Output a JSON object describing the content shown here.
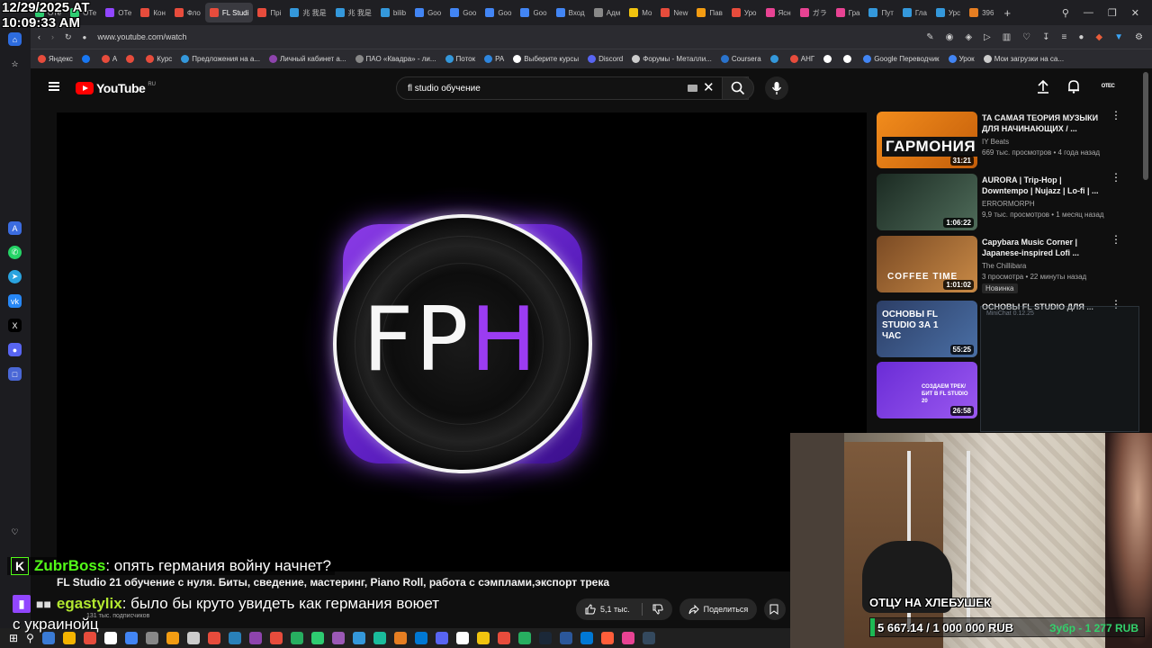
{
  "clock": {
    "date": "12/29/2025 AT",
    "time": "10:09:33 AM"
  },
  "tabs": [
    {
      "label": "ОТе",
      "color": "#2ecc71"
    },
    {
      "label": "ОТе",
      "color": "#2ecc71"
    },
    {
      "label": "ОТе",
      "color": "#9146ff"
    },
    {
      "label": "Кон",
      "color": "#e74c3c"
    },
    {
      "label": "Фло",
      "color": "#e74c3c"
    },
    {
      "label": "FL Studi",
      "color": "#e74c3c",
      "active": true
    },
    {
      "label": "Прі",
      "color": "#e74c3c"
    },
    {
      "label": "兆 我是",
      "color": "#3498db"
    },
    {
      "label": "兆 我是",
      "color": "#3498db"
    },
    {
      "label": "bilib",
      "color": "#3498db"
    },
    {
      "label": "Goo",
      "color": "#4285f4"
    },
    {
      "label": "Goo",
      "color": "#4285f4"
    },
    {
      "label": "Goo",
      "color": "#4285f4"
    },
    {
      "label": "Goo",
      "color": "#4285f4"
    },
    {
      "label": "Вход",
      "color": "#4285f4"
    },
    {
      "label": "Адм",
      "color": "#888888"
    },
    {
      "label": "Мо",
      "color": "#f1c40f"
    },
    {
      "label": "New",
      "color": "#e74c3c"
    },
    {
      "label": "Пав",
      "color": "#f39c12"
    },
    {
      "label": "Уро",
      "color": "#e74c3c"
    },
    {
      "label": "Ясн",
      "color": "#e84393"
    },
    {
      "label": "ガラ",
      "color": "#e84393"
    },
    {
      "label": "Гра",
      "color": "#e84393"
    },
    {
      "label": "Пут",
      "color": "#3498db"
    },
    {
      "label": "Гла",
      "color": "#3498db"
    },
    {
      "label": "Урс",
      "color": "#3498db"
    },
    {
      "label": "396",
      "color": "#e67e22"
    }
  ],
  "address": {
    "url": "www.youtube.com/watch"
  },
  "bookmarks": [
    {
      "label": "Яндекс",
      "color": "#e74c3c"
    },
    {
      "label": "",
      "color": "#1877f2"
    },
    {
      "label": "А",
      "color": "#e74c3c"
    },
    {
      "label": "",
      "color": "#e74c3c"
    },
    {
      "label": "Курс",
      "color": "#e74c3c"
    },
    {
      "label": "Предложения на а...",
      "color": "#3498db"
    },
    {
      "label": "Личный кабинет а...",
      "color": "#8e44ad"
    },
    {
      "label": "ПАО «Квадра» - ли...",
      "color": "#888888"
    },
    {
      "label": "Поток",
      "color": "#3498db"
    },
    {
      "label": "РА",
      "color": "#2e86de"
    },
    {
      "label": "Выберите курсы",
      "color": "#ffffff"
    },
    {
      "label": "Discord",
      "color": "#5865f2"
    },
    {
      "label": "Форумы - Металли...",
      "color": "#cccccc"
    },
    {
      "label": "Coursera",
      "color": "#2a73cc"
    },
    {
      "label": "",
      "color": "#3498db"
    },
    {
      "label": "АНГ",
      "color": "#e74c3c"
    },
    {
      "label": "",
      "color": "#ffffff"
    },
    {
      "label": "",
      "color": "#ffffff"
    },
    {
      "label": "Google Переводчик",
      "color": "#4285f4"
    },
    {
      "label": "Урок",
      "color": "#4285f4"
    },
    {
      "label": "Мои загрузки на са...",
      "color": "#cccccc"
    }
  ],
  "youtube": {
    "logo": "YouTube",
    "region": "RU",
    "search_value": "fl studio обучение",
    "avatar_text": "OTEC",
    "video_title": "FL Studio 21 обучение с нуля. Биты, сведение, мастеринг, Piano Roll, работа с сэмплами,экспорт трека",
    "subs": "131 тыс. подписчиков",
    "likes": "5,1 тыс.",
    "share": "Поделиться",
    "logo_text_f": "FP",
    "logo_text_h": "H"
  },
  "recommendations": [
    {
      "title": "ТА САМАЯ ТЕОРИЯ МУЗЫКИ ДЛЯ НАЧИНАЮЩИХ / ...",
      "channel": "IY Beats",
      "meta": "669 тыс. просмотров • 4 года назад",
      "duration": "31:21",
      "thumb_text": "ГАРМОНИЯ",
      "color1": "#f28c1c",
      "color2": "#c45e0a"
    },
    {
      "title": "AURORA | Trip-Hop | Downtempo | Nujazz | Lo-fi | ...",
      "channel": "ERRORMORPH",
      "meta": "9,9 тыс. просмотров • 1 месяц назад",
      "duration": "1:06:22",
      "thumb_text": "",
      "color1": "#1b2a22",
      "color2": "#4f6c5a"
    },
    {
      "title": "Capybara Music Corner | Japanese-inspired Lofi ...",
      "channel": "The Chillibara",
      "meta": "3 просмотра • 22 минуты назад",
      "badge": "Новинка",
      "duration": "1:01:02",
      "thumb_text": "COFFEE TIME",
      "color1": "#7a4a24",
      "color2": "#c98a46"
    },
    {
      "title": "ОСНОВЫ FL STUDIO ДЛЯ ...",
      "channel": "",
      "meta": "",
      "duration": "55:25",
      "thumb_text": "ОСНОВЫ FL STUDIO ЗА 1 ЧАС",
      "color1": "#2c3e66",
      "color2": "#4a6fa5"
    },
    {
      "title": "",
      "channel": "",
      "meta": "",
      "duration": "26:58",
      "thumb_text": "СОЗДАЕМ ТРЕК/БИТ В FL STUDIO 20",
      "color1": "#6a2cd6",
      "color2": "#9b59f0"
    }
  ],
  "minichat": {
    "title": "MiniChat 0.12.25"
  },
  "chat": {
    "msg1_user": "ZubrBoss",
    "msg1_text": ": опять германия войну начнет?",
    "msg2_user": "egastylix",
    "msg2_text": ": было бы круто увидеть как германия воюет",
    "msg2_cont": "с украинойц"
  },
  "goal": {
    "label": "ОТЦУ НА ХЛЕБУШЕК",
    "progress_text": "5 667.14 / 1 000 000 RUB",
    "last_donation": "Зубр - 1 277 RUB",
    "fraction": 0.0057
  },
  "taskbar_icons": [
    "#3a7bd5",
    "#f4b400",
    "#e74c3c",
    "#ffffff",
    "#4285f4",
    "#888888",
    "#f39c12",
    "#cccccc",
    "#e74c3c",
    "#2980b9",
    "#8e44ad",
    "#e74c3c",
    "#27ae60",
    "#2ecc71",
    "#9b59b6",
    "#3498db",
    "#1abc9c",
    "#e67e22",
    "#0078d4",
    "#5865f2",
    "#ffffff",
    "#f1c40f",
    "#e74c3c",
    "#27ae60",
    "#1b2838",
    "#2b579a",
    "#0078d4",
    "#ff5e3a",
    "#e84393",
    "#34495e"
  ]
}
